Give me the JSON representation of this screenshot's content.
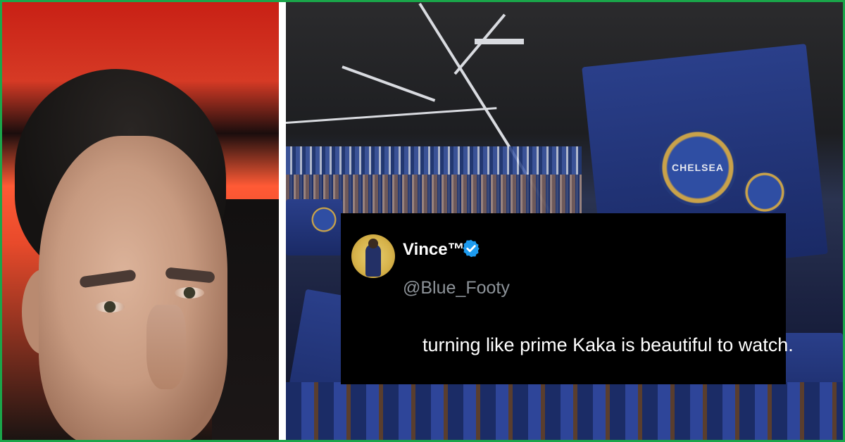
{
  "tweet": {
    "display_name": "Vince™",
    "handle": "@Blue_Footy",
    "text": "turning like prime Kaka is beautiful to watch."
  },
  "stadium": {
    "flag_crest_text": "CHELSEA"
  },
  "colors": {
    "frame": "#1aa64a",
    "tweet_background": "#000000",
    "verified_badge": "#1d9bf0",
    "handle_text": "#8d9399"
  },
  "icons": {
    "verified": "verified-badge-icon"
  }
}
